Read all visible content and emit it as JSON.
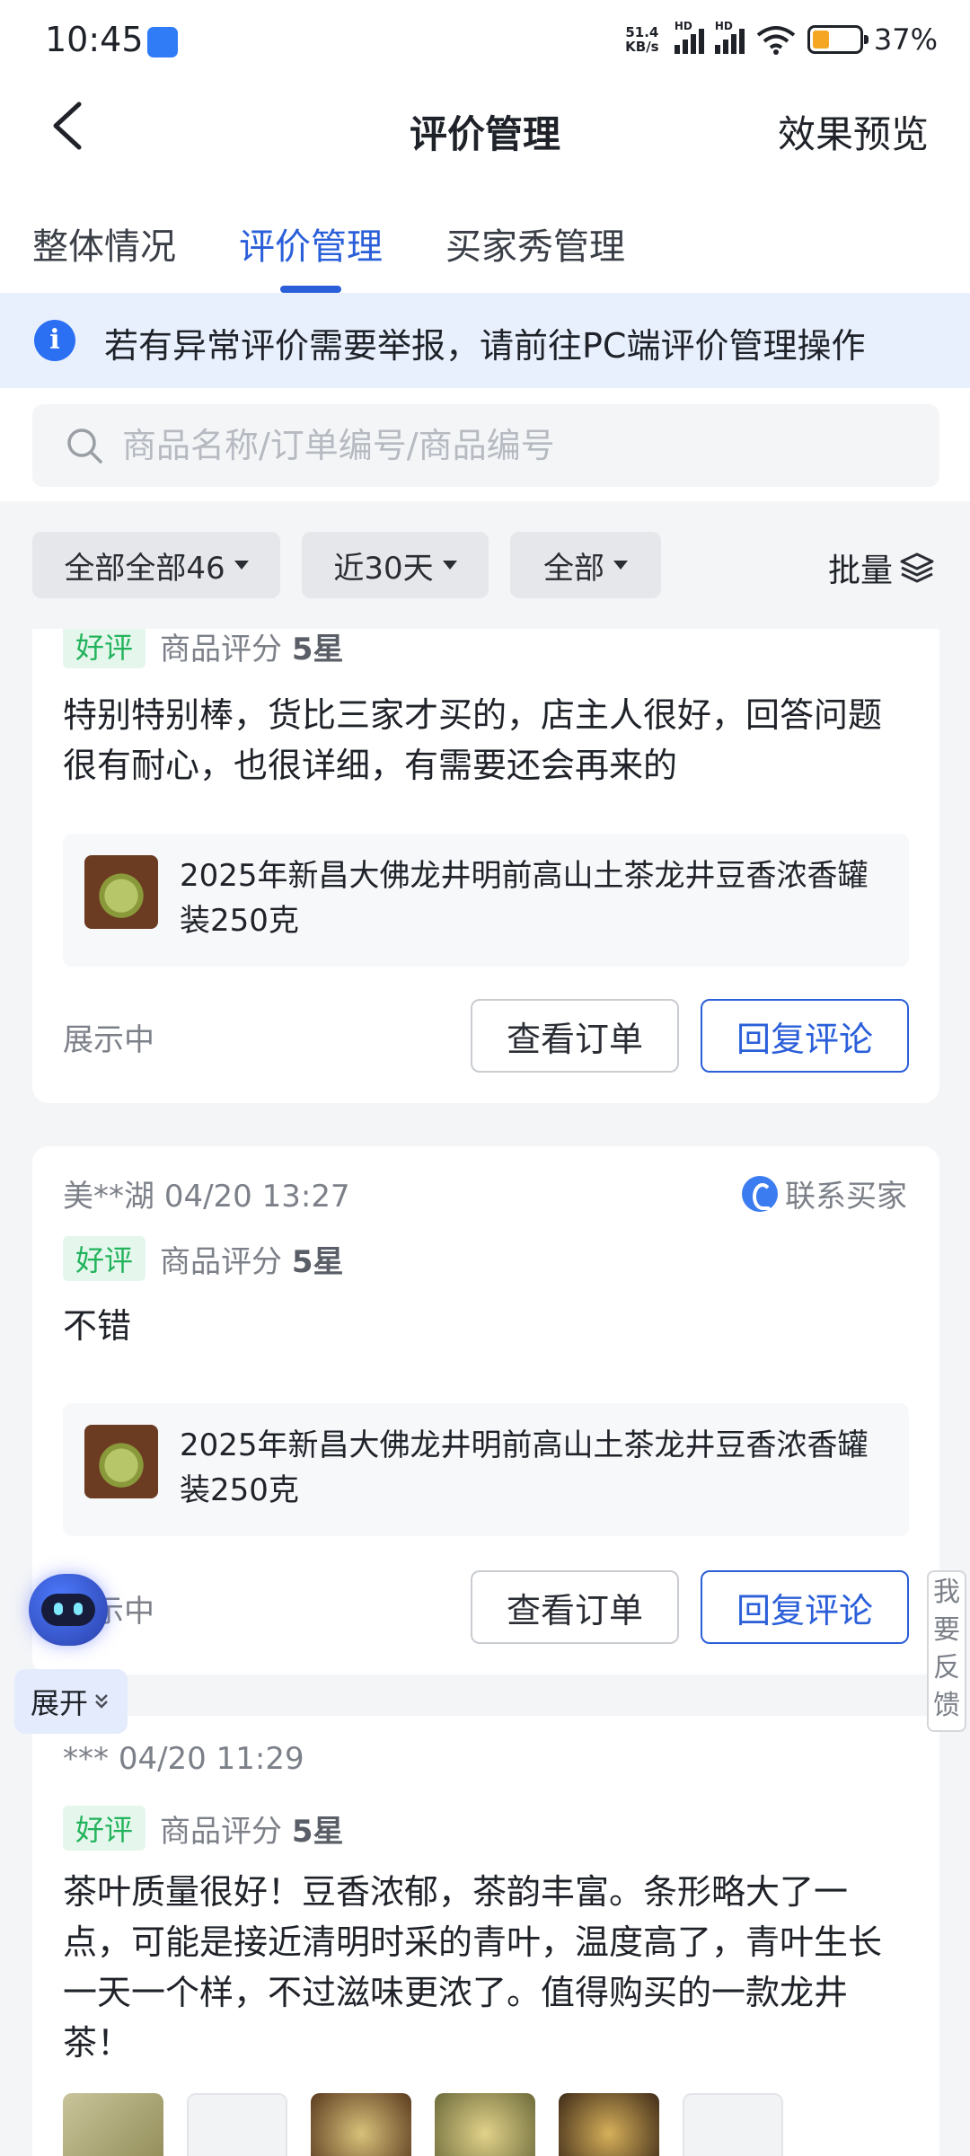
{
  "status_bar": {
    "time": "10:45",
    "net_speed_value": "51.4",
    "net_speed_unit": "KB/s",
    "signal_label": "HD",
    "battery_level_percent": 37,
    "battery": "37%"
  },
  "nav": {
    "title": "评价管理",
    "action": "效果预览"
  },
  "tabs": [
    {
      "label": "整体情况",
      "active": false
    },
    {
      "label": "评价管理",
      "active": true
    },
    {
      "label": "买家秀管理",
      "active": false
    }
  ],
  "notice": {
    "icon": "i",
    "text": "若有异常评价需要举报，请前往PC端评价管理操作"
  },
  "search": {
    "placeholder": "商品名称/订单编号/商品编号",
    "value": ""
  },
  "filters": [
    {
      "label": "全部全部46"
    },
    {
      "label": "近30天"
    },
    {
      "label": "全部"
    }
  ],
  "batch_label": "批量",
  "reviews": [
    {
      "user": "",
      "time": "",
      "badge": "好评",
      "score_label": "商品评分",
      "score": "5星",
      "text": "特别特别棒，货比三家才买的，店主人很好，回答问题很有耐心，也很详细，有需要还会再来的",
      "product": "2025年新昌大佛龙井明前高山土茶龙井豆香浓香罐装250克",
      "status": "展示中",
      "view_order": "查看订单",
      "reply": "回复评论"
    },
    {
      "user": "美**湖",
      "time": "04/20 13:27",
      "contact": "联系买家",
      "badge": "好评",
      "score_label": "商品评分",
      "score": "5星",
      "text": "不错",
      "product": "2025年新昌大佛龙井明前高山土茶龙井豆香浓香罐装250克",
      "status": "展示中",
      "view_order": "查看订单",
      "reply": "回复评论"
    },
    {
      "user": "***",
      "time": "04/20 11:29",
      "badge": "好评",
      "score_label": "商品评分",
      "score": "5星",
      "text": "茶叶质量很好！豆香浓郁，茶韵丰富。条形略大了一点，可能是接近清明时采的青叶，温度高了，青叶生长一天一个样，不过滋味更浓了。值得购买的一款龙井茶！"
    }
  ],
  "float_assistant": {
    "expand_label": "展开"
  },
  "feedback": {
    "label": "我要反馈"
  },
  "colors": {
    "accent": "#2b5fd9",
    "good_badge": "#23b35c",
    "notice_bg": "#e9f0fd"
  }
}
